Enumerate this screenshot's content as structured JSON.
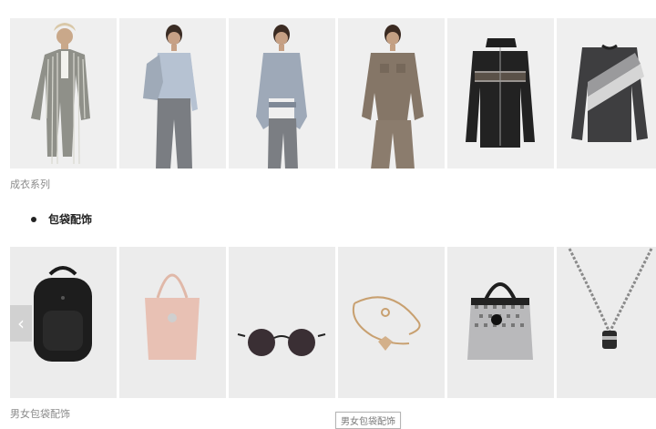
{
  "apparel": {
    "caption": "成衣系列",
    "items": [
      {
        "icon": "plaid-suit-photo"
      },
      {
        "icon": "blue-cropped-jacket-photo"
      },
      {
        "icon": "belted-blazer-photo"
      },
      {
        "icon": "utility-jacket-photo"
      },
      {
        "icon": "black-zip-jacket-photo"
      },
      {
        "icon": "grey-sweater-photo"
      }
    ]
  },
  "section": {
    "title": "包袋配饰"
  },
  "accessories": {
    "caption": "男女包袋配饰",
    "tooltip": "男女包袋配饰",
    "items": [
      {
        "icon": "black-backpack-photo"
      },
      {
        "icon": "pink-tote-photo"
      },
      {
        "icon": "sunglasses-photo"
      },
      {
        "icon": "gold-bracelet-photo"
      },
      {
        "icon": "logo-handbag-photo"
      },
      {
        "icon": "chain-necklace-photo"
      }
    ],
    "prev_arrow": "‹"
  }
}
